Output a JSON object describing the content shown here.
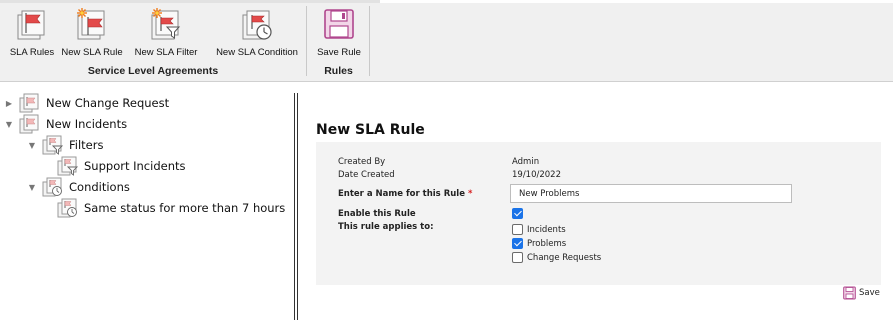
{
  "ribbon": {
    "groups": [
      {
        "label": "Service Level Agreements",
        "buttons": [
          {
            "label": "SLA Rules",
            "icon": "sla-rules-icon"
          },
          {
            "label": "New SLA Rule",
            "icon": "new-sla-rule-icon"
          },
          {
            "label": "New SLA Filter",
            "icon": "new-sla-filter-icon"
          },
          {
            "label": "New SLA Condition",
            "icon": "new-sla-condition-icon"
          }
        ]
      },
      {
        "label": "Rules",
        "buttons": [
          {
            "label": "Save Rule",
            "icon": "floppy-disk-icon"
          }
        ]
      }
    ]
  },
  "tree": {
    "items": [
      {
        "label": "New Change Request",
        "state": "collapsed"
      },
      {
        "label": "New Incidents",
        "state": "expanded"
      },
      {
        "label": "Filters",
        "state": "expanded"
      },
      {
        "label": "Support Incidents",
        "state": "leaf"
      },
      {
        "label": "Conditions",
        "state": "expanded"
      },
      {
        "label": "Same status for more than 7 hours",
        "state": "leaf"
      }
    ]
  },
  "main": {
    "title": "New SLA Rule",
    "form": {
      "created_by_label": "Created By",
      "created_by_value": "Admin",
      "date_created_label": "Date Created",
      "date_created_value": "19/10/2022",
      "name_label": "Enter a Name for this Rule",
      "required_marker": "*",
      "name_value": "New Problems",
      "enable_label": "Enable this Rule",
      "enable_checked": true,
      "applies_label": "This rule applies to:",
      "applies_options": [
        {
          "label": "Incidents",
          "checked": false
        },
        {
          "label": "Problems",
          "checked": true
        },
        {
          "label": "Change Requests",
          "checked": false
        }
      ]
    },
    "save_label": "Save"
  },
  "colors": {
    "flag_red": "#e34a4a",
    "accent_purple": "#b0478e",
    "checkbox_blue": "#1a73e8",
    "starburst_orange": "#f07a1a"
  }
}
